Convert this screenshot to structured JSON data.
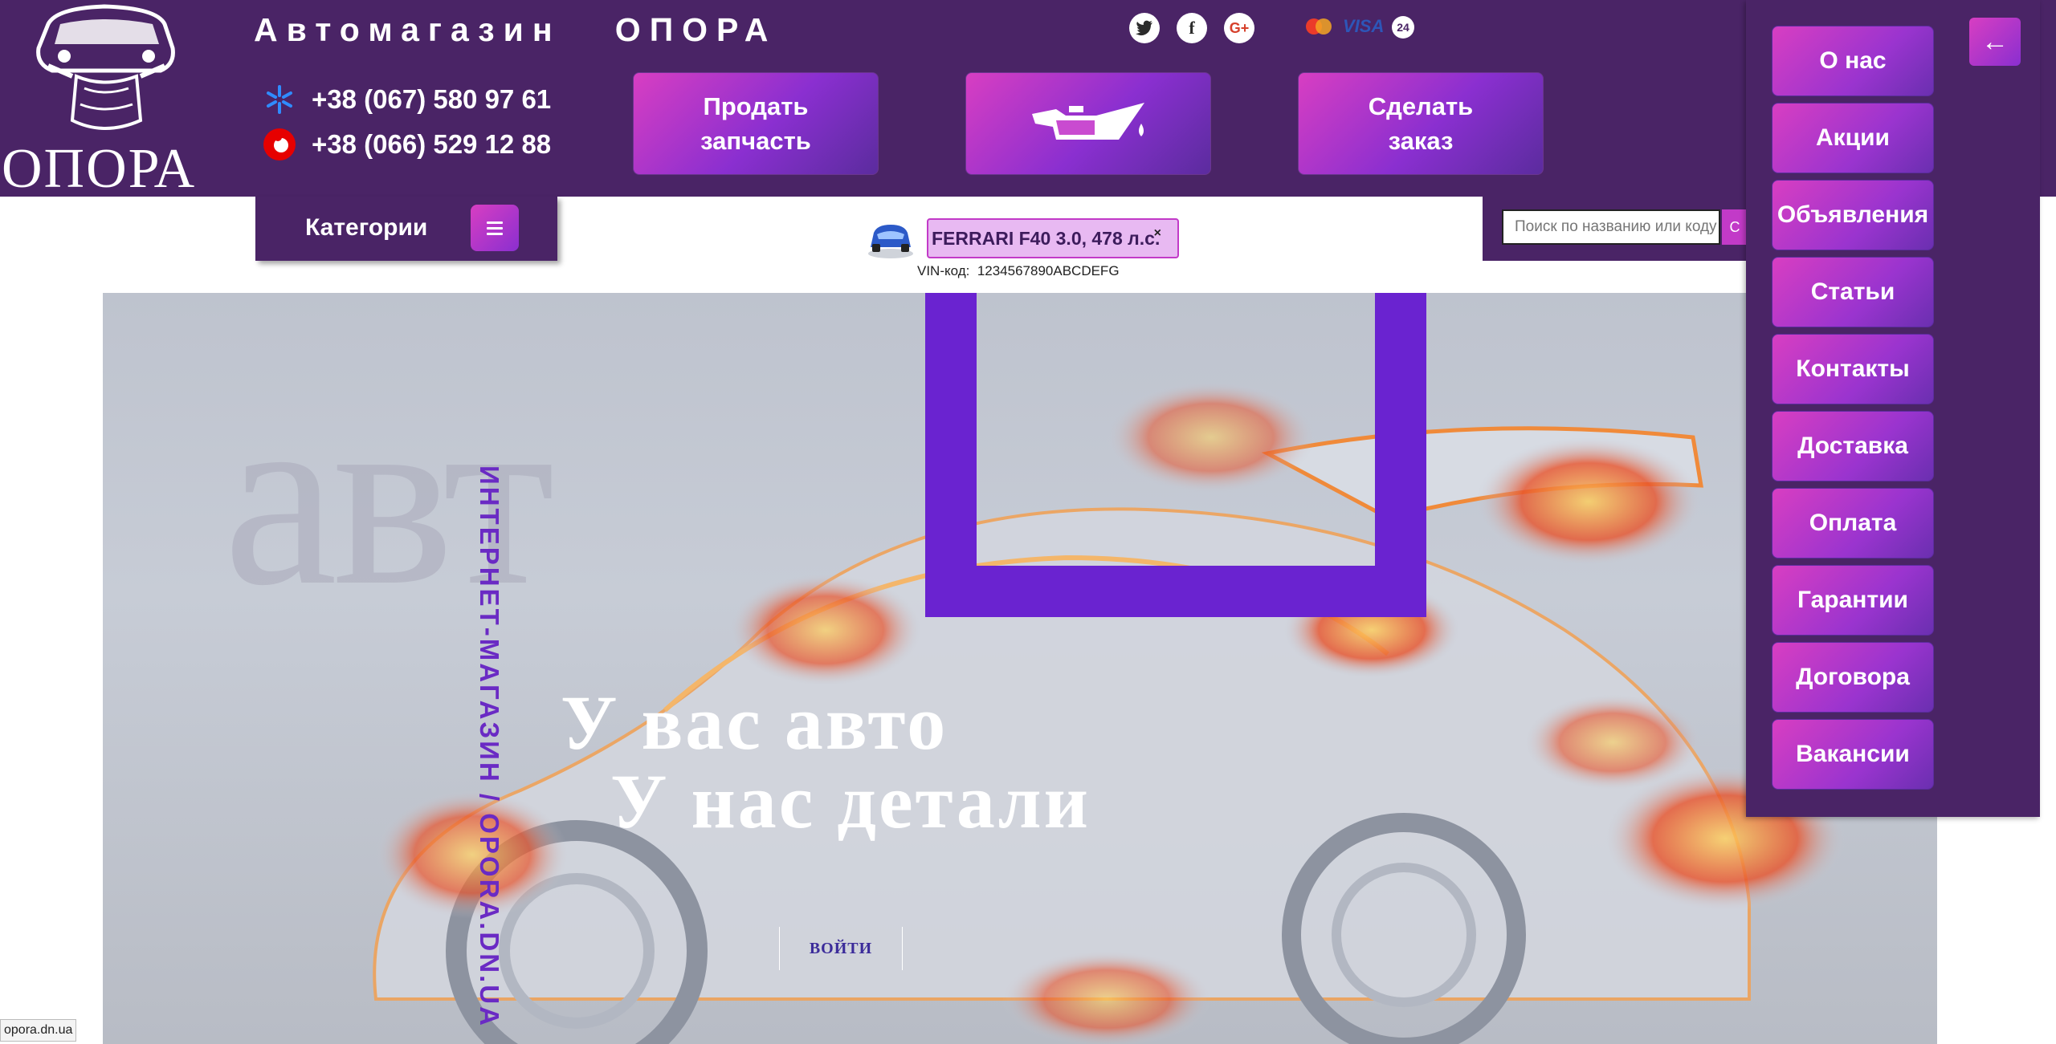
{
  "header": {
    "logo_text": "ОПОРА",
    "site_title": "Автомагазин   ОПОРА",
    "phones": [
      {
        "operator_icon": "kyivstar-star-icon",
        "number": "+38 (067) 580 97 61"
      },
      {
        "operator_icon": "vodafone-icon",
        "number": "+38 (066) 529 12 88"
      }
    ],
    "sell_part_button": "Продать\nзапчасть",
    "oil_button_icon": "oil-can-icon",
    "make_order_button": "Сделать\nзаказ",
    "social": [
      "twitter-icon",
      "facebook-icon",
      "google-plus-icon"
    ],
    "payments": [
      "mastercard-icon",
      "visa-icon",
      "24"
    ]
  },
  "subbar": {
    "categories_label": "Категории",
    "selected_car": "FERRARI F40 3.0, 478 л.с.",
    "close_symbol": "×",
    "vin_label": "VIN-код:",
    "vin_value": "1234567890ABCDEFG",
    "search_placeholder": "Поиск по названию или коду",
    "search_button": "С"
  },
  "hero": {
    "watermark": "авт",
    "vertical_text": "ИНТЕРНЕТ-МАГАЗИН / OPORA.DN.UA",
    "slogan_line1": "У вас авто",
    "slogan_line2": "У нас детали",
    "login": "ВОЙТИ"
  },
  "side_menu": {
    "back_symbol": "←",
    "items": [
      "О нас",
      "Акции",
      "Объявления",
      "Статьи",
      "Контакты",
      "Доставка",
      "Оплата",
      "Гарантии",
      "Договора",
      "Вакансии"
    ]
  },
  "status_url": "opora.dn.ua",
  "colors": {
    "header_bg": "#4a2466",
    "accent_pink": "#d83ec2",
    "accent_purple": "#8a2fd0",
    "frame_purple": "#6a23d0"
  }
}
